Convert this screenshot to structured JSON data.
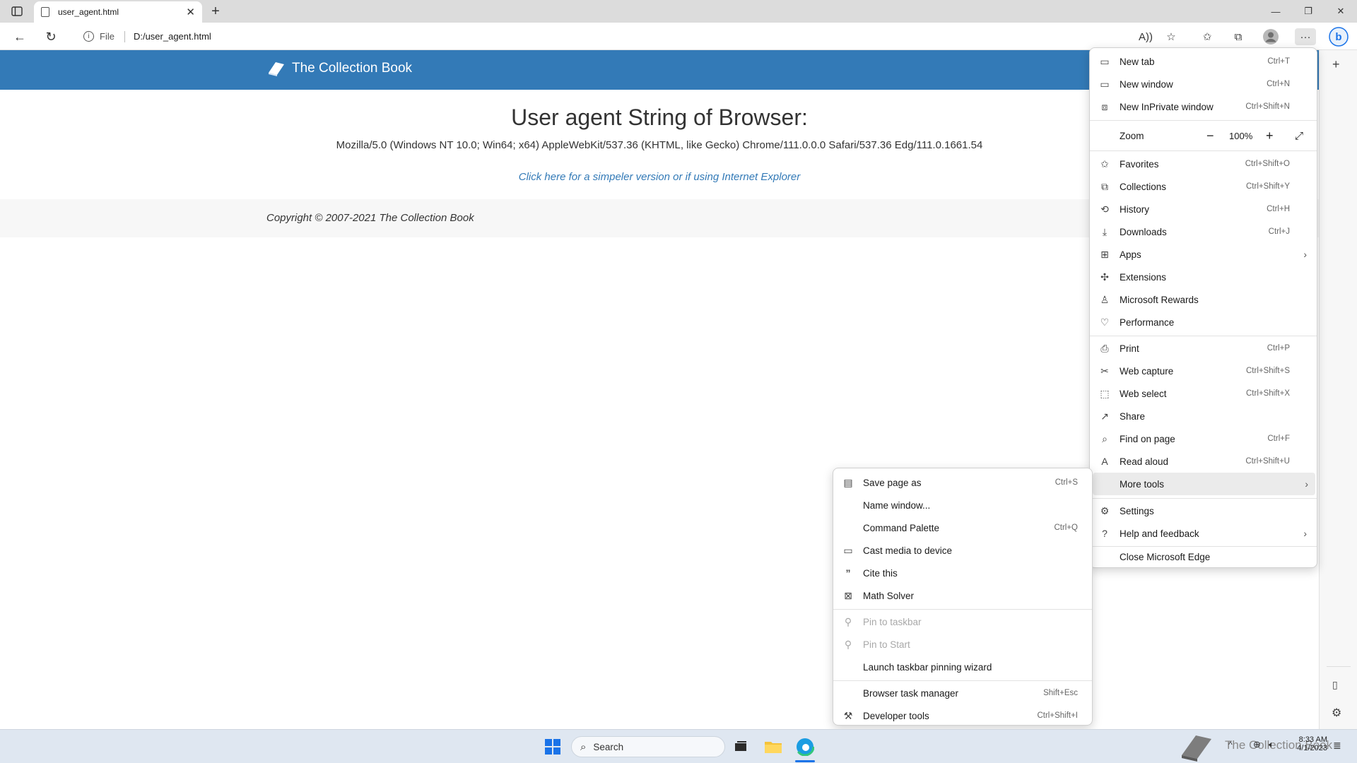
{
  "browser": {
    "tab_title": "user_agent.html",
    "address_scheme": "File",
    "address_url": "D:/user_agent.html"
  },
  "page": {
    "brand": "The Collection Book",
    "heading": "User agent String of Browser:",
    "user_agent": "Mozilla/5.0 (Windows NT 10.0; Win64; x64) AppleWebKit/537.36 (KHTML, like Gecko) Chrome/111.0.0.0 Safari/537.36 Edg/111.0.1661.54",
    "simple_link": "Click here for a simpeler version or if using Internet Explorer",
    "copyright": "Copyright © 2007-2021 The Collection Book"
  },
  "main_menu": {
    "items": [
      {
        "label": "New tab",
        "shortcut": "Ctrl+T"
      },
      {
        "label": "New window",
        "shortcut": "Ctrl+N"
      },
      {
        "label": "New InPrivate window",
        "shortcut": "Ctrl+Shift+N"
      },
      {
        "label": "Zoom",
        "value": "100%"
      },
      {
        "label": "Favorites",
        "shortcut": "Ctrl+Shift+O"
      },
      {
        "label": "Collections",
        "shortcut": "Ctrl+Shift+Y"
      },
      {
        "label": "History",
        "shortcut": "Ctrl+H"
      },
      {
        "label": "Downloads",
        "shortcut": "Ctrl+J"
      },
      {
        "label": "Apps"
      },
      {
        "label": "Extensions"
      },
      {
        "label": "Microsoft Rewards"
      },
      {
        "label": "Performance"
      },
      {
        "label": "Print",
        "shortcut": "Ctrl+P"
      },
      {
        "label": "Web capture",
        "shortcut": "Ctrl+Shift+S"
      },
      {
        "label": "Web select",
        "shortcut": "Ctrl+Shift+X"
      },
      {
        "label": "Share"
      },
      {
        "label": "Find on page",
        "shortcut": "Ctrl+F"
      },
      {
        "label": "Read aloud",
        "shortcut": "Ctrl+Shift+U"
      },
      {
        "label": "More tools"
      },
      {
        "label": "Settings"
      },
      {
        "label": "Help and feedback"
      },
      {
        "label": "Close Microsoft Edge"
      }
    ]
  },
  "more_tools_menu": {
    "items": [
      {
        "label": "Save page as",
        "shortcut": "Ctrl+S"
      },
      {
        "label": "Name window..."
      },
      {
        "label": "Command Palette",
        "shortcut": "Ctrl+Q"
      },
      {
        "label": "Cast media to device"
      },
      {
        "label": "Cite this"
      },
      {
        "label": "Math Solver"
      },
      {
        "label": "Pin to taskbar",
        "disabled": true
      },
      {
        "label": "Pin to Start",
        "disabled": true
      },
      {
        "label": "Launch taskbar pinning wizard"
      },
      {
        "label": "Browser task manager",
        "shortcut": "Shift+Esc"
      },
      {
        "label": "Developer tools",
        "shortcut": "Ctrl+Shift+I"
      }
    ]
  },
  "taskbar": {
    "search_placeholder": "Search",
    "watermark": "The Collection Book",
    "time": "8:33 AM",
    "date": "4/1/2023"
  },
  "colors": {
    "header_blue": "#337ab7",
    "taskbar_bg": "#dfe7f1"
  }
}
